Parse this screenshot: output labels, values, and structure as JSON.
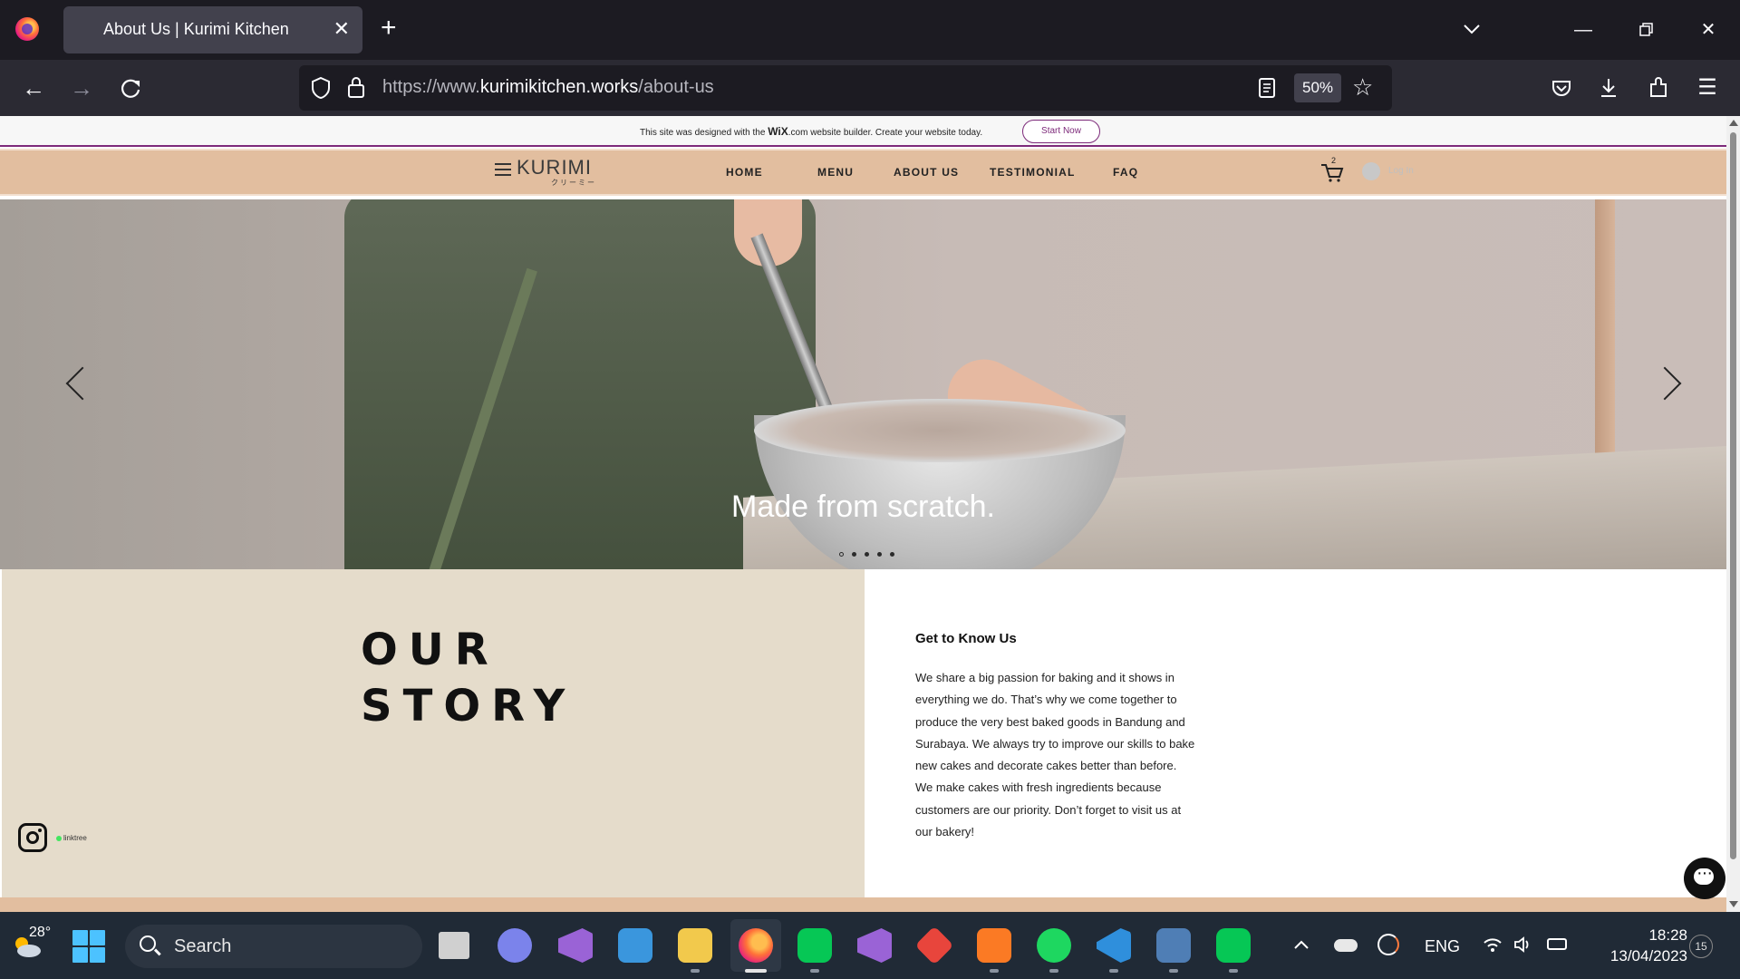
{
  "browser": {
    "tab_title": "About Us | Kurimi Kitchen",
    "url_scheme_host_prefix": "https://www.",
    "url_domain": "kurimikitchen.works",
    "url_path": "/about-us",
    "zoom_level": "50%"
  },
  "wix_banner": {
    "text_prefix": "This site was designed with the ",
    "wix_logo": "WiX",
    "text_suffix": ".com website builder. Create your website today.",
    "button_label": "Start Now"
  },
  "site_header": {
    "logo_text": "KURIMI",
    "logo_subtext": "クリーミー",
    "nav": [
      "HOME",
      "MENU",
      "ABOUT US",
      "TESTIMONIAL",
      "FAQ"
    ],
    "cart_count": "2",
    "login_label": "Log In"
  },
  "hero": {
    "caption": "Made from scratch.",
    "slide_count": 5,
    "active_slide": 1
  },
  "story": {
    "title_line1": "OUR",
    "title_line2": "STORY",
    "linktree_label": "linktree",
    "heading": "Get to Know Us",
    "body": "We share a big passion for baking and it shows in everything we do. That’s why we come together to produce the very best baked goods in Bandung and Surabaya. We always try to improve our skills to bake new cakes and decorate cakes better than before.  We make cakes with fresh ingredients because customers are our priority. Don’t forget to visit us at our bakery!"
  },
  "taskbar": {
    "weather_temp": "28°",
    "search_label": "Search",
    "language": "ENG",
    "time": "18:28",
    "date": "13/04/2023",
    "notification_count": "15",
    "apps": [
      {
        "name": "task-view",
        "color": "#d0d0d0"
      },
      {
        "name": "teams-chat",
        "color": "#7b83eb"
      },
      {
        "name": "visual-studio",
        "color": "#9a63d6"
      },
      {
        "name": "microsoft-store",
        "color": "#3a96dd"
      },
      {
        "name": "file-explorer",
        "color": "#f2c94c"
      },
      {
        "name": "firefox",
        "color": "#ff7139"
      },
      {
        "name": "line",
        "color": "#06c755"
      },
      {
        "name": "visual-studio-2",
        "color": "#9a63d6"
      },
      {
        "name": "git-tool",
        "color": "#e8453c"
      },
      {
        "name": "xampp",
        "color": "#fb7a24"
      },
      {
        "name": "spotify",
        "color": "#1ed760"
      },
      {
        "name": "vscode",
        "color": "#2f8fdc"
      },
      {
        "name": "mysql-workbench",
        "color": "#4f7eb5"
      },
      {
        "name": "line-2",
        "color": "#06c755"
      }
    ]
  }
}
